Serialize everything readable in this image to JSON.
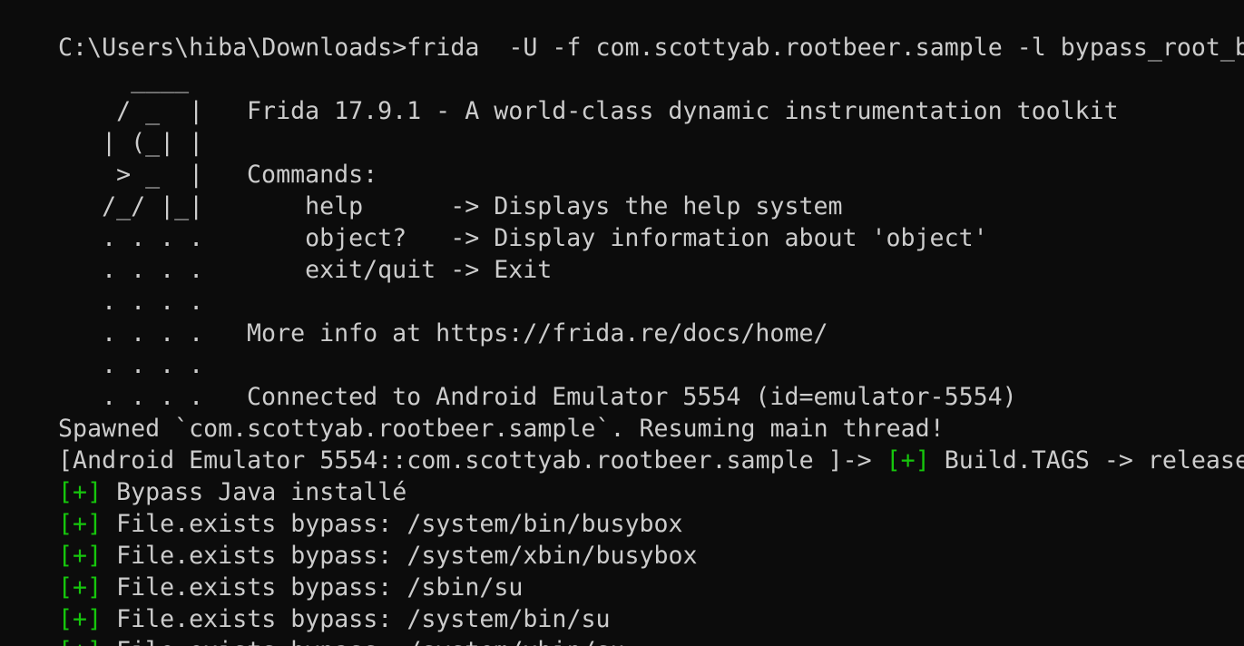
{
  "terminal": {
    "command": "C:\\Users\\hiba\\Downloads>frida  -U -f com.scottyab.rootbeer.sample -l bypass_root_basic",
    "banner": {
      "logo": [
        "     ____",
        "    / _  |",
        "   | (_| |",
        "    > _  |",
        "   /_/ |_|",
        "   . . . .",
        "   . . . .",
        "   . . . .",
        "   . . . .",
        "   . . . .",
        "   . . . ."
      ],
      "title": "Frida 17.9.1 - A world-class dynamic instrumentation toolkit",
      "commands_header": "Commands:",
      "commands": [
        "    help      -> Displays the help system",
        "    object?   -> Display information about 'object'",
        "    exit/quit -> Exit"
      ],
      "more_info": "More info at https://frida.re/docs/home/",
      "connected": "Connected to Android Emulator 5554 (id=emulator-5554)"
    },
    "spawned": "Spawned `com.scottyab.rootbeer.sample`. Resuming main thread!",
    "prompt": "[Android Emulator 5554::com.scottyab.rootbeer.sample ]-> ",
    "marker": "[+]",
    "build_tags": " Build.TAGS -> release-keys",
    "output": [
      " Bypass Java installé",
      " File.exists bypass: /system/bin/busybox",
      " File.exists bypass: /system/xbin/busybox",
      " File.exists bypass: /sbin/su",
      " File.exists bypass: /system/bin/su",
      " File.exists bypass: /system/xbin/su"
    ],
    "colors": {
      "background": "#0c0c0c",
      "text": "#cccccc",
      "success_marker": "#16c60c"
    }
  }
}
